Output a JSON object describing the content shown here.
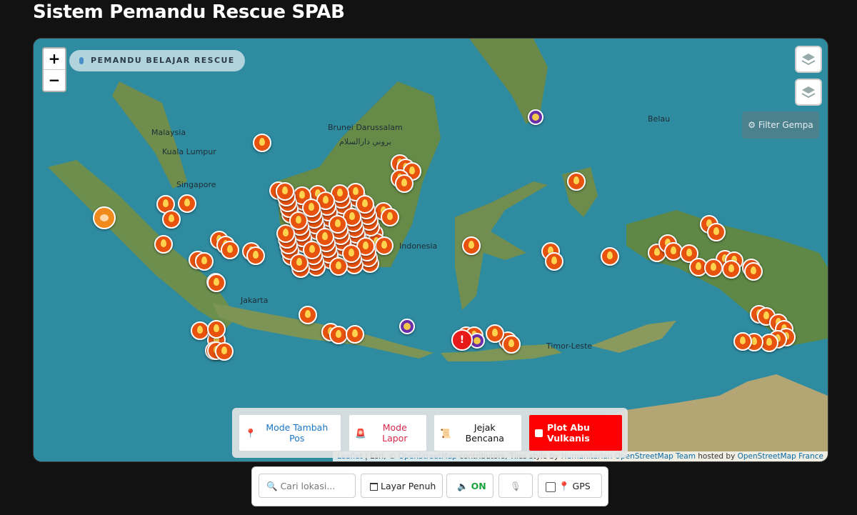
{
  "page_title": "Sistem Pemandu Rescue SPAB",
  "map": {
    "badge": "PEMANDU BELAJAR RESCUE",
    "zoom_in": "+",
    "zoom_out": "−",
    "filter_label": "Filter Gempa",
    "filter_icon": "gear-icon",
    "labels": {
      "malaysia": "Malaysia",
      "kuala_lumpur": "Kuala Lumpur",
      "singapore": "Singapore",
      "brunei": "Brunei Darussalam",
      "brunei_ar": "بروني دارالسلام",
      "indonesia": "Indonesia",
      "jakarta": "Jakarta",
      "belau": "Belau",
      "timor": "Timor-Leste"
    },
    "attribution": {
      "leaflet": "Leaflet",
      "esri": " | Esri, © ",
      "osm": "OpenStreetMap",
      "contrib": " contributors, Tiles style by ",
      "hot": "Humanitarian OpenStreetMap Team",
      "hosted": " hosted by ",
      "osmfr": "OpenStreetMap France"
    },
    "alert_mark": "!"
  },
  "modes": {
    "tambah_pos": "Mode Tambah Pos",
    "lapor": "Mode Lapor",
    "jejak": "Jejak Bencana",
    "plot_abu": "Plot Abu Vulkanis"
  },
  "toolbar": {
    "search_placeholder": "Cari lokasi...",
    "layar_penuh": "Layar Penuh",
    "sound_on": "ON",
    "gps": "GPS"
  },
  "colors": {
    "fire": "#e8520f",
    "alert": "#e81919",
    "plot_abu_bg": "#ff0000",
    "sound_on": "#1aa33a",
    "lapor_text": "#d9264a",
    "tambah_text": "#1b76c9"
  }
}
